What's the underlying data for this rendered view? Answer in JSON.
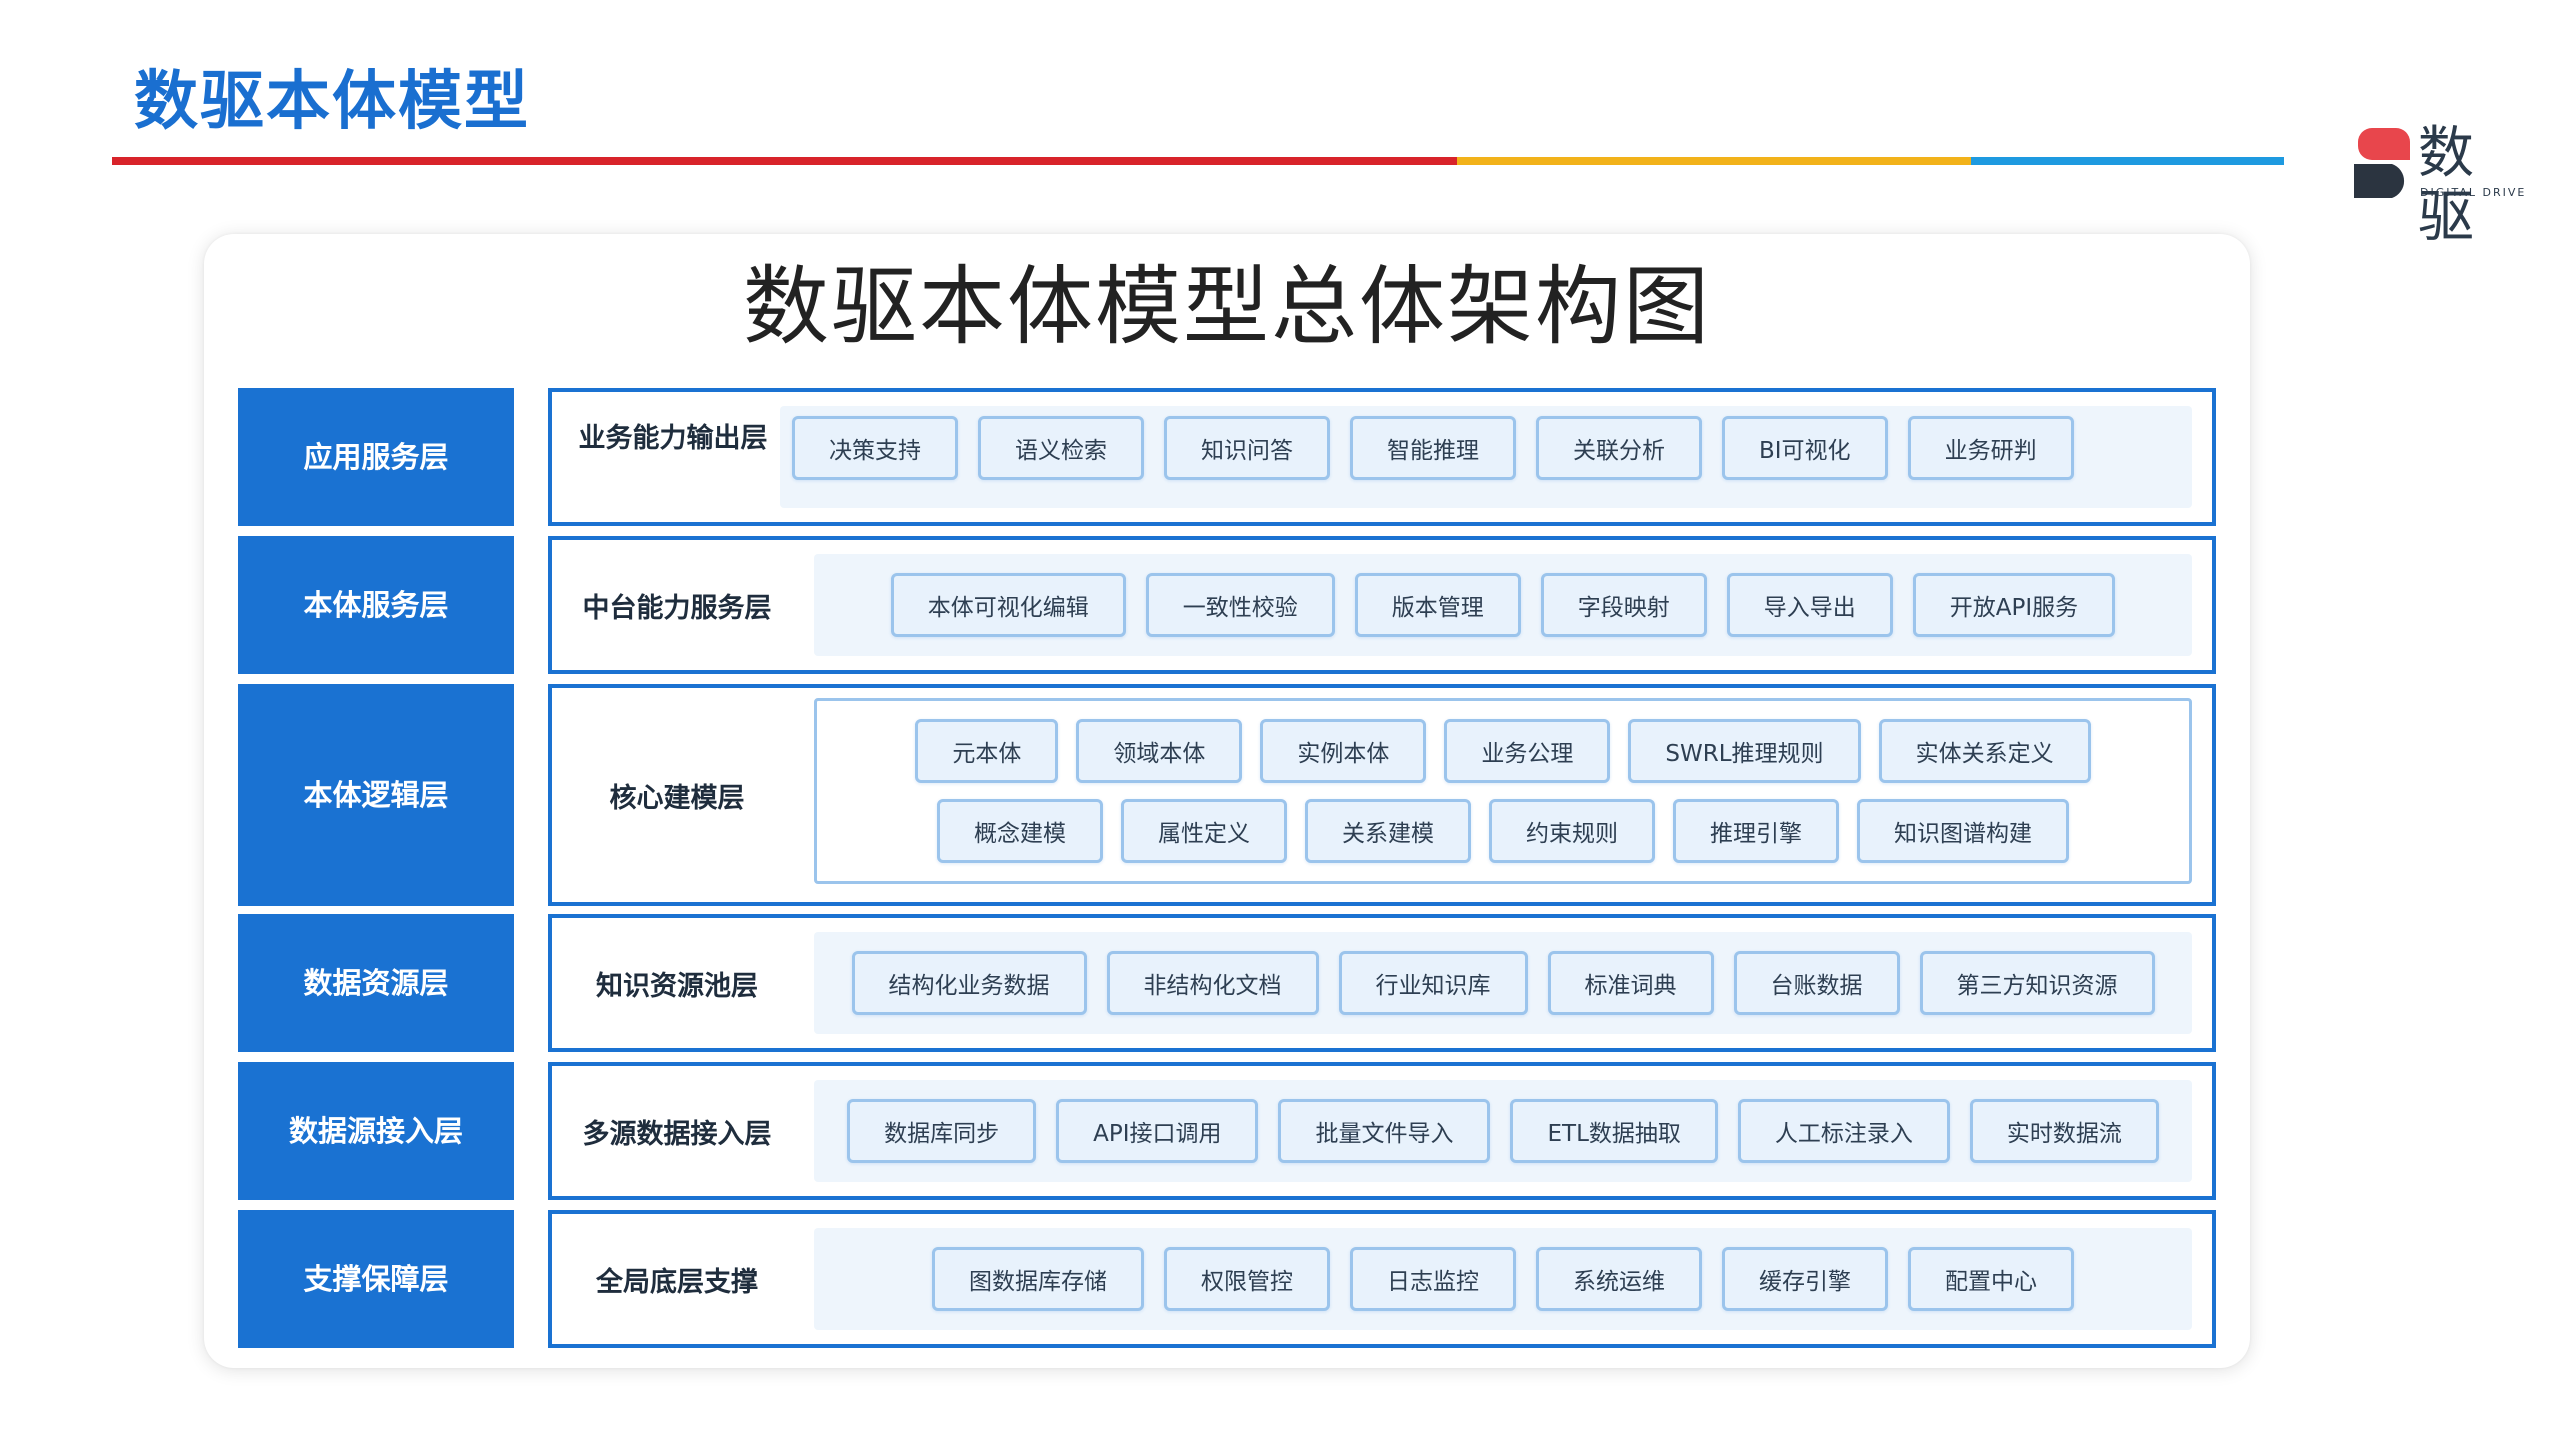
{
  "header": {
    "title": "数驱本体模型",
    "colors": {
      "red": "#d8232a",
      "yellow": "#f2b21a",
      "blue": "#1e9ae0",
      "accent": "#1a72d2"
    }
  },
  "logo": {
    "text": "数驱",
    "subtitle": "DIGITAL DRIVE",
    "icon": "digital-drive-logo-mark"
  },
  "diagram": {
    "title": "数驱本体模型总体架构图",
    "layers": [
      {
        "label": "应用服务层",
        "sublayer": "业务能力输出层",
        "items": [
          "决策支持",
          "语义检索",
          "知识问答",
          "智能推理",
          "关联分析",
          "BI可视化",
          "业务研判"
        ]
      },
      {
        "label": "本体服务层",
        "sublayer": "中台能力服务层",
        "items": [
          "本体可视化编辑",
          "一致性校验",
          "版本管理",
          "字段映射",
          "导入导出",
          "开放API服务"
        ]
      },
      {
        "label": "本体逻辑层",
        "sublayer": "核心建模层",
        "items": [
          "元本体",
          "领域本体",
          "实例本体",
          "业务公理",
          "SWRL推理规则",
          "实体关系定义",
          "概念建模",
          "属性定义",
          "关系建模",
          "约束规则",
          "推理引擎",
          "知识图谱构建"
        ]
      },
      {
        "label": "数据资源层",
        "sublayer": "知识资源池层",
        "items": [
          "结构化业务数据",
          "非结构化文档",
          "行业知识库",
          "标准词典",
          "台账数据",
          "第三方知识资源"
        ]
      },
      {
        "label": "数据源接入层",
        "sublayer": "多源数据接入层",
        "items": [
          "数据库同步",
          "API接口调用",
          "批量文件导入",
          "ETL数据抽取",
          "人工标注录入",
          "实时数据流"
        ]
      },
      {
        "label": "支撑保障层",
        "sublayer": "全局底层支撑",
        "items": [
          "图数据库存储",
          "权限管控",
          "日志监控",
          "系统运维",
          "缓存引擎",
          "配置中心"
        ]
      }
    ]
  }
}
